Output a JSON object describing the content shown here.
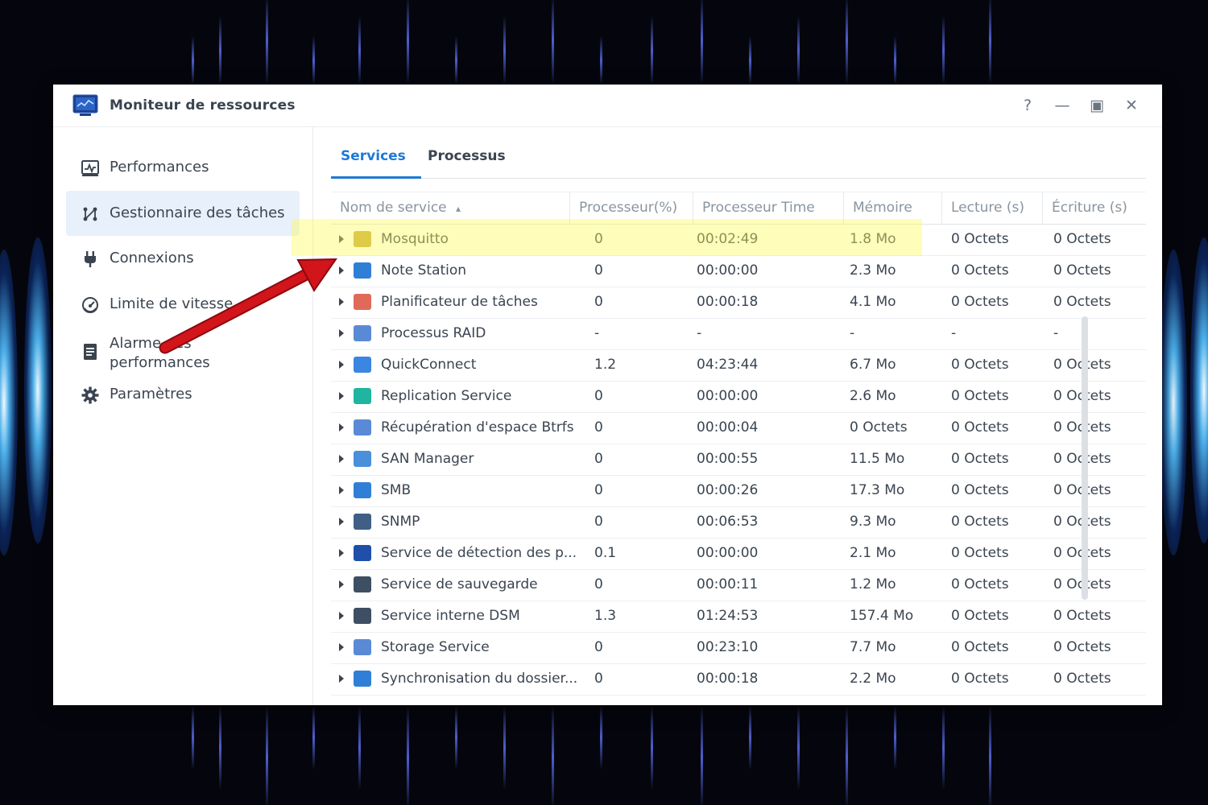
{
  "window": {
    "title": "Moniteur de ressources"
  },
  "window_controls": {
    "help": "?",
    "minimize": "—",
    "maximize": "▣",
    "close": "✕"
  },
  "sidebar": {
    "items": [
      {
        "label": "Performances",
        "icon": "performance-chart-icon",
        "active": false
      },
      {
        "label": "Gestionnaire des tâches",
        "icon": "task-manager-icon",
        "active": true
      },
      {
        "label": "Connexions",
        "icon": "plug-icon",
        "active": false
      },
      {
        "label": "Limite de vitesse",
        "icon": "speedometer-icon",
        "active": false
      },
      {
        "label": "Alarme des performances",
        "label_lines": [
          "Alarme des",
          "performances"
        ],
        "icon": "document-alarm-icon",
        "active": false
      },
      {
        "label": "Paramètres",
        "icon": "gear-icon",
        "active": false
      }
    ]
  },
  "tabs": [
    {
      "label": "Services",
      "active": true
    },
    {
      "label": "Processus",
      "active": false
    }
  ],
  "table": {
    "columns": [
      "Nom de service",
      "Processeur(%)",
      "Processeur Time",
      "Mémoire",
      "Lecture (s)",
      "Écriture (s)"
    ],
    "sort_indicator": "▴",
    "rows": [
      {
        "name": "Mosquitto",
        "cpu": "0",
        "time": "00:02:49",
        "mem": "1.8 Mo",
        "read": "0 Octets",
        "write": "0 Octets",
        "icon": "mosquitto-icon",
        "color": "#c9a93a"
      },
      {
        "name": "Note Station",
        "cpu": "0",
        "time": "00:00:00",
        "mem": "2.3 Mo",
        "read": "0 Octets",
        "write": "0 Octets",
        "icon": "note-station-icon",
        "color": "#2f7fd6"
      },
      {
        "name": "Planificateur de tâches",
        "cpu": "0",
        "time": "00:00:18",
        "mem": "4.1 Mo",
        "read": "0 Octets",
        "write": "0 Octets",
        "icon": "calendar-icon",
        "color": "#e06a5a"
      },
      {
        "name": "Processus RAID",
        "cpu": "-",
        "time": "-",
        "mem": "-",
        "read": "-",
        "write": "-",
        "icon": "raid-process-icon",
        "color": "#5a8ad6"
      },
      {
        "name": "QuickConnect",
        "cpu": "1.2",
        "time": "04:23:44",
        "mem": "6.7 Mo",
        "read": "0 Octets",
        "write": "0 Octets",
        "icon": "quickconnect-icon",
        "color": "#3a86e0"
      },
      {
        "name": "Replication Service",
        "cpu": "0",
        "time": "00:00:00",
        "mem": "2.6 Mo",
        "read": "0 Octets",
        "write": "0 Octets",
        "icon": "replication-icon",
        "color": "#1fb5a0"
      },
      {
        "name": "Récupération d'espace Btrfs",
        "cpu": "0",
        "time": "00:00:04",
        "mem": "0 Octets",
        "read": "0 Octets",
        "write": "0 Octets",
        "icon": "btrfs-icon",
        "color": "#5a8ad6"
      },
      {
        "name": "SAN Manager",
        "cpu": "0",
        "time": "00:00:55",
        "mem": "11.5 Mo",
        "read": "0 Octets",
        "write": "0 Octets",
        "icon": "san-manager-icon",
        "color": "#4a8fd9"
      },
      {
        "name": "SMB",
        "cpu": "0",
        "time": "00:00:26",
        "mem": "17.3 Mo",
        "read": "0 Octets",
        "write": "0 Octets",
        "icon": "smb-icon",
        "color": "#2f7fd6"
      },
      {
        "name": "SNMP",
        "cpu": "0",
        "time": "00:06:53",
        "mem": "9.3 Mo",
        "read": "0 Octets",
        "write": "0 Octets",
        "icon": "snmp-icon",
        "color": "#3f5f86"
      },
      {
        "name": "Service de détection des p...",
        "cpu": "0.1",
        "time": "00:00:00",
        "mem": "2.1 Mo",
        "read": "0 Octets",
        "write": "0 Octets",
        "icon": "detection-service-icon",
        "color": "#1f4fa8"
      },
      {
        "name": "Service de sauvegarde",
        "cpu": "0",
        "time": "00:00:11",
        "mem": "1.2 Mo",
        "read": "0 Octets",
        "write": "0 Octets",
        "icon": "backup-gear-icon",
        "color": "#3e4f63"
      },
      {
        "name": "Service interne DSM",
        "cpu": "1.3",
        "time": "01:24:53",
        "mem": "157.4 Mo",
        "read": "0 Octets",
        "write": "0 Octets",
        "icon": "dsm-gear-icon",
        "color": "#3e4f63"
      },
      {
        "name": "Storage Service",
        "cpu": "0",
        "time": "00:23:10",
        "mem": "7.7 Mo",
        "read": "0 Octets",
        "write": "0 Octets",
        "icon": "storage-icon",
        "color": "#5a8ad6"
      },
      {
        "name": "Synchronisation du dossier...",
        "cpu": "0",
        "time": "00:00:18",
        "mem": "2.2 Mo",
        "read": "0 Octets",
        "write": "0 Octets",
        "icon": "folder-sync-icon",
        "color": "#2f7fd6"
      }
    ]
  },
  "colors": {
    "accent": "#1d7ad6",
    "highlight": "#fcfa5a",
    "arrow": "#d2141b",
    "text": "#3a4450",
    "header_text": "#8a949e"
  }
}
